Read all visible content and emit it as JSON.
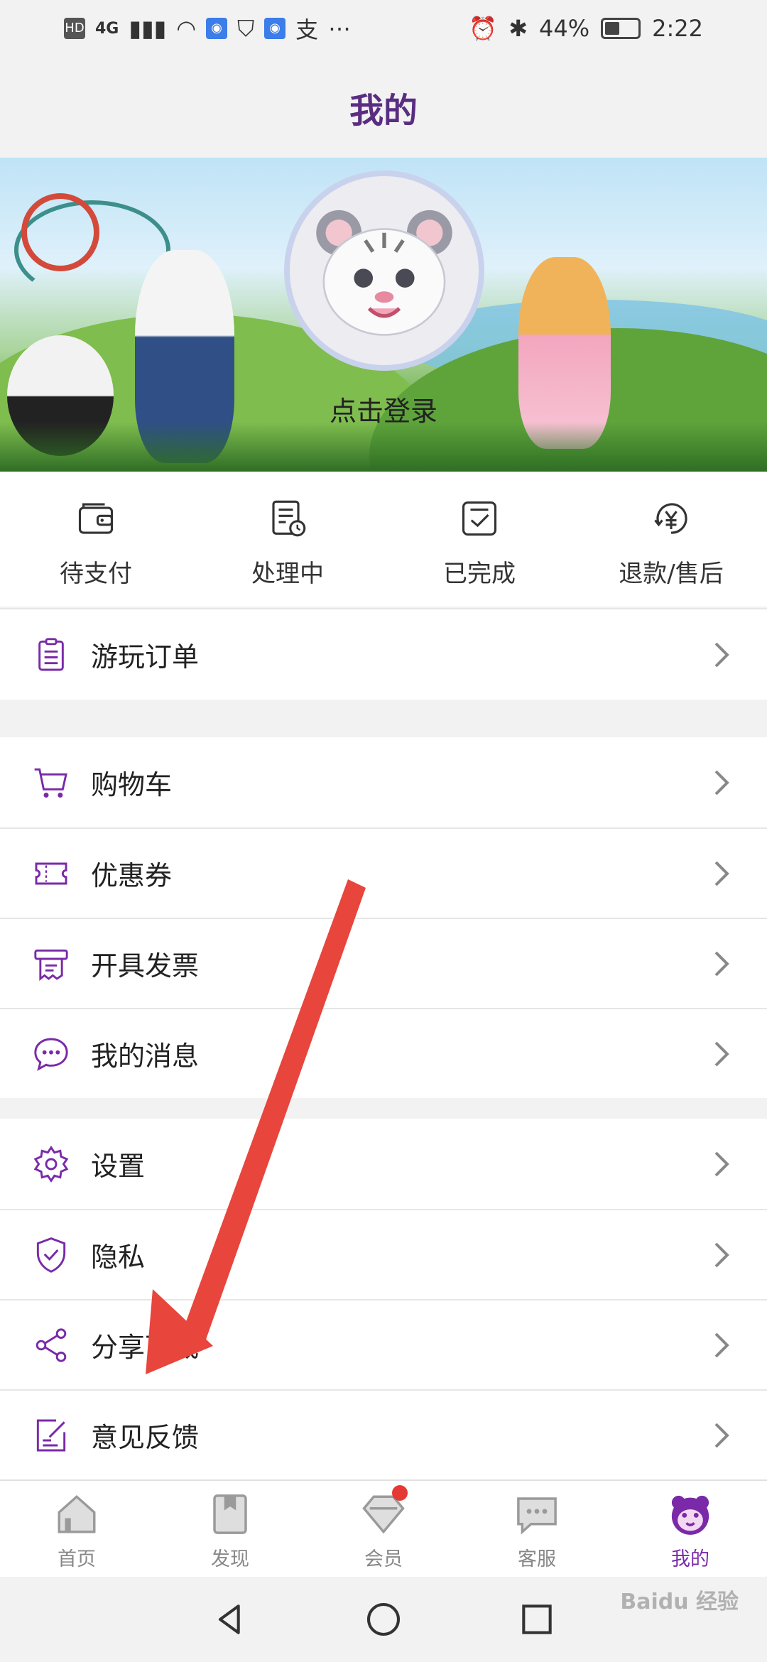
{
  "status_bar": {
    "left_badges": [
      "HD",
      "4G"
    ],
    "battery": "44%",
    "time": "2:22"
  },
  "header": {
    "title": "我的"
  },
  "profile": {
    "login_text": "点击登录"
  },
  "orders": [
    {
      "label": "待支付",
      "icon": "wallet-icon"
    },
    {
      "label": "处理中",
      "icon": "document-clock-icon"
    },
    {
      "label": "已完成",
      "icon": "checked-box-icon"
    },
    {
      "label": "退款/售后",
      "icon": "refund-yen-icon"
    }
  ],
  "menu_group_1": [
    {
      "label": "游玩订单",
      "icon": "clipboard-icon"
    }
  ],
  "menu_group_2": [
    {
      "label": "购物车",
      "icon": "cart-icon"
    },
    {
      "label": "优惠券",
      "icon": "coupon-icon"
    },
    {
      "label": "开具发票",
      "icon": "invoice-icon"
    },
    {
      "label": "我的消息",
      "icon": "message-icon"
    }
  ],
  "menu_group_3": [
    {
      "label": "设置",
      "icon": "gear-icon"
    },
    {
      "label": "隐私",
      "icon": "shield-icon"
    },
    {
      "label": "分享下载",
      "icon": "share-icon"
    },
    {
      "label": "意见反馈",
      "icon": "feedback-icon"
    }
  ],
  "tabbar": [
    {
      "label": "首页",
      "icon": "home-icon",
      "active": false
    },
    {
      "label": "发现",
      "icon": "bookmark-icon",
      "active": false
    },
    {
      "label": "会员",
      "icon": "diamond-icon",
      "active": false,
      "badge": true
    },
    {
      "label": "客服",
      "icon": "chat-icon",
      "active": false
    },
    {
      "label": "我的",
      "icon": "tiger-face-icon",
      "active": true
    }
  ],
  "watermark": "Baidu 经验",
  "colors": {
    "accent": "#7a2aa8",
    "header_title": "#5a2d82",
    "arrow": "#e8453c",
    "badge": "#e53935"
  }
}
